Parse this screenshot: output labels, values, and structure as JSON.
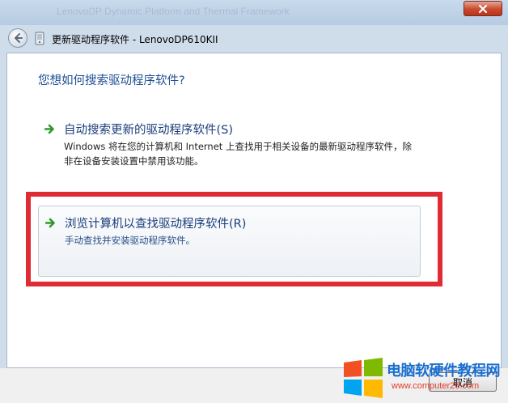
{
  "window": {
    "background_caption": "LenovoDP Dynamic Platform and Thermal Framework",
    "title": "更新驱动程序软件 - LenovoDP610KII",
    "close_icon": "close-icon"
  },
  "dialog": {
    "question": "您想如何搜索驱动程序软件?",
    "options": [
      {
        "title": "自动搜索更新的驱动程序软件(S)",
        "description": "Windows 将在您的计算机和 Internet 上查找用于相关设备的最新驱动程序软件，除非在设备安装设置中禁用该功能。",
        "icon": "green-arrow-icon"
      },
      {
        "title": "浏览计算机以查找驱动程序软件(R)",
        "description": "手动查找并安装驱动程序软件。",
        "icon": "green-arrow-icon"
      }
    ],
    "cancel_label": "取消"
  },
  "watermark": {
    "name": "电脑软硬件教程网",
    "url": "www.computer26.com"
  },
  "colors": {
    "highlight": "#e12b34",
    "link_blue": "#1a3d7a",
    "heading_blue": "#1d4f91"
  }
}
